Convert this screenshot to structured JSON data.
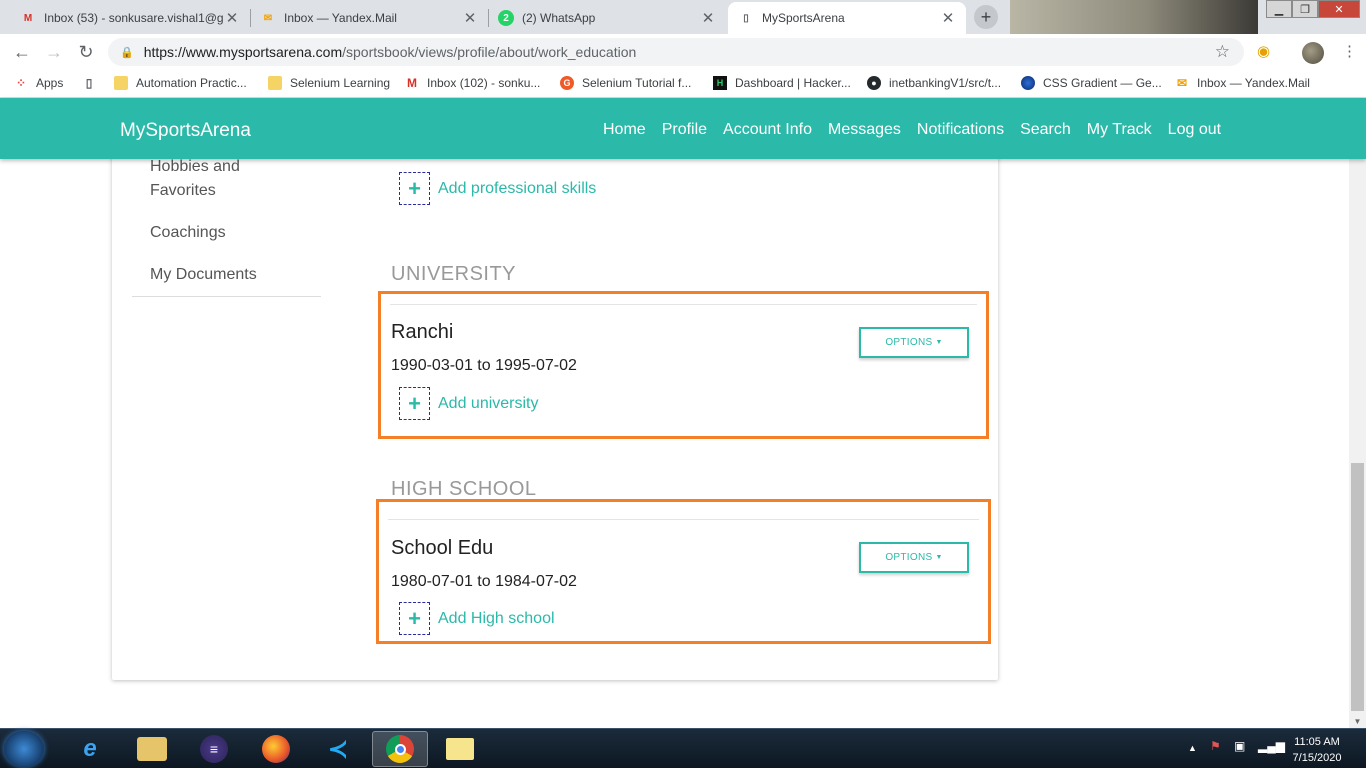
{
  "browser": {
    "tabs": [
      {
        "title": "Inbox (53) - sonkusare.vishal1@g",
        "icon": "gmail-icon",
        "active": false
      },
      {
        "title": "Inbox — Yandex.Mail",
        "icon": "yandex-mail-icon",
        "active": false
      },
      {
        "title": "(2) WhatsApp",
        "icon": "whatsapp-icon",
        "active": false
      },
      {
        "title": "MySportsArena",
        "icon": "page-icon",
        "active": true
      }
    ],
    "url_host": "https://www.mysportsarena.com",
    "url_path": "/sportsbook/views/profile/about/work_education",
    "bookmarks": [
      {
        "label": "Apps",
        "icon": "apps-grid-icon"
      },
      {
        "label": "",
        "icon": "page-icon"
      },
      {
        "label": "Automation Practic...",
        "icon": "folder-icon"
      },
      {
        "label": "Selenium Learning",
        "icon": "folder-icon"
      },
      {
        "label": "Inbox (102) - sonku...",
        "icon": "gmail-icon"
      },
      {
        "label": "Selenium Tutorial f...",
        "icon": "guru99-icon"
      },
      {
        "label": "Dashboard | Hacker...",
        "icon": "hackerrank-icon"
      },
      {
        "label": "inetbankingV1/src/t...",
        "icon": "github-icon"
      },
      {
        "label": "CSS Gradient — Ge...",
        "icon": "css-gradient-icon"
      },
      {
        "label": "Inbox — Yandex.Mail",
        "icon": "yandex-mail-icon"
      }
    ]
  },
  "site": {
    "brand": "MySportsArena",
    "menu": [
      "Home",
      "Profile",
      "Account Info",
      "Messages",
      "Notifications",
      "Search",
      "My Track",
      "Log out"
    ]
  },
  "sidebar": {
    "items": [
      "Hobbies and Favorites",
      "Coachings",
      "My Documents"
    ]
  },
  "professional_skills": {
    "add_label": "Add professional skills"
  },
  "university": {
    "heading": "UNIVERSITY",
    "entry_title": "Ranchi",
    "entry_dates": "1990-03-01 to 1995-07-02",
    "options_label": "OPTIONS",
    "add_label": "Add university"
  },
  "high_school": {
    "heading": "HIGH SCHOOL",
    "entry_title": "School Edu",
    "entry_dates": "1980-07-01 to 1984-07-02",
    "options_label": "OPTIONS",
    "add_label": "Add High school"
  },
  "colors": {
    "brand_teal": "#2bb9a9",
    "highlight_orange": "#f57f26"
  },
  "taskbar": {
    "apps": [
      "start-icon",
      "internet-explorer-icon",
      "file-explorer-icon",
      "eclipse-icon",
      "firefox-icon",
      "vscode-icon",
      "chrome-icon",
      "sticky-notes-icon"
    ],
    "time": "11:05 AM",
    "date": "7/15/2020"
  }
}
